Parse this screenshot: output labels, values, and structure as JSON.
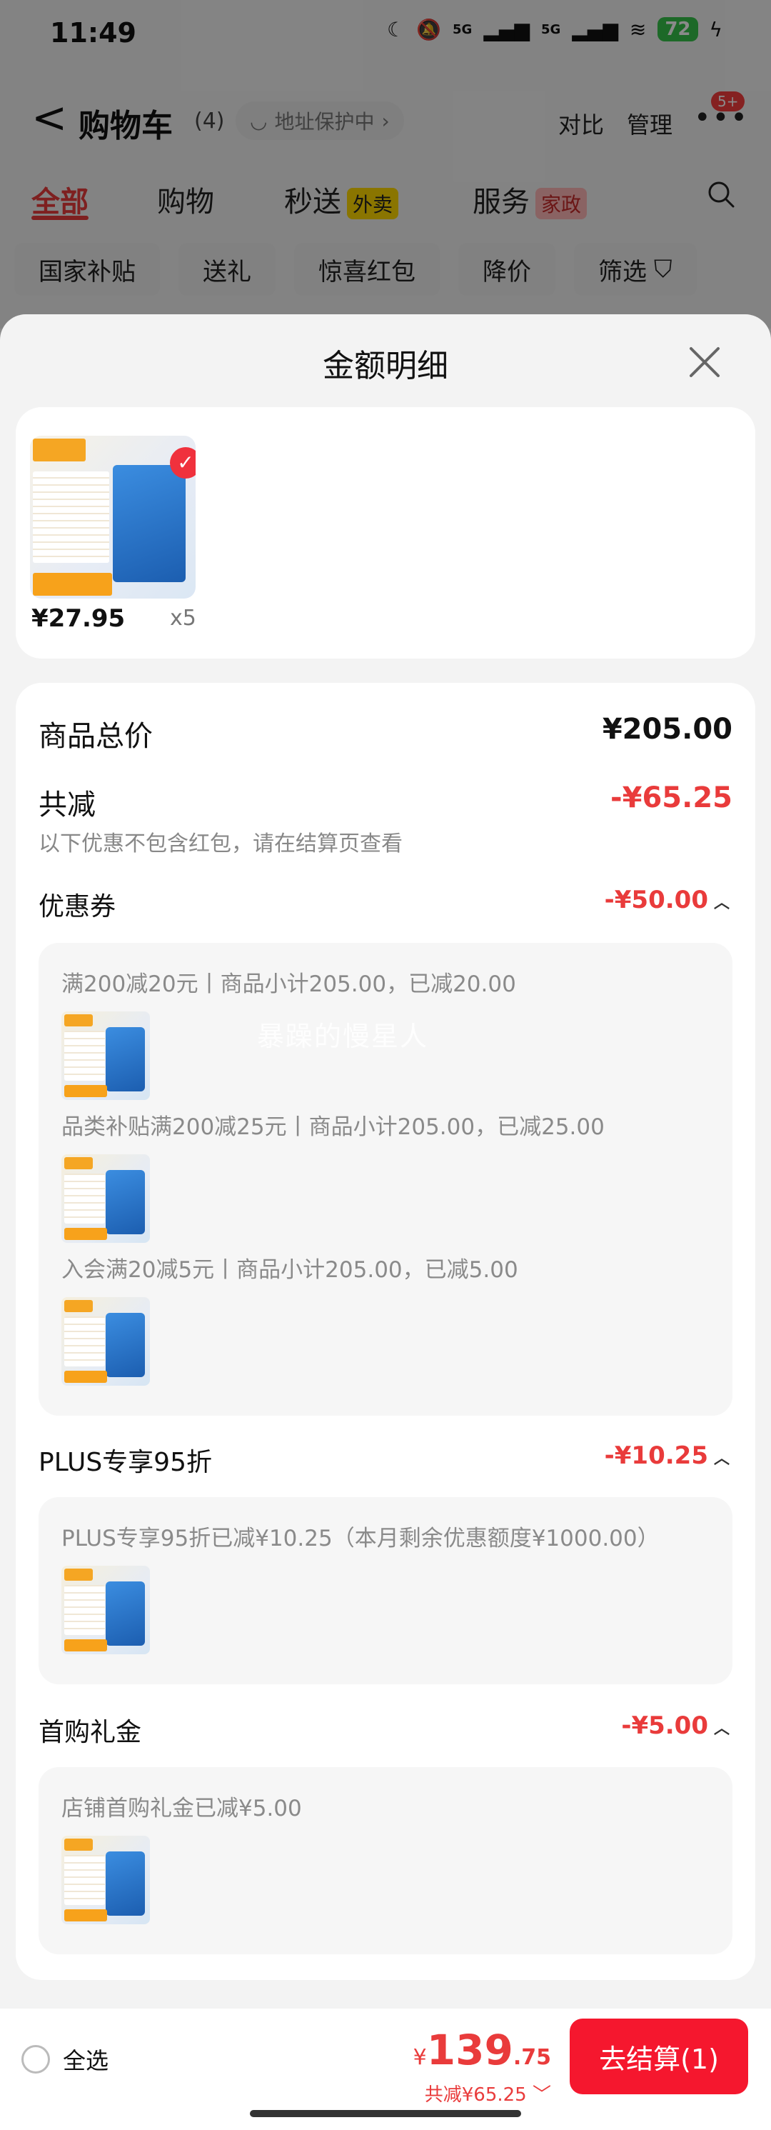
{
  "status_bar": {
    "time": "11:49",
    "signal1": "5G",
    "signal2": "5G",
    "battery": "72"
  },
  "nav": {
    "back_glyph": "<",
    "title": "购物车",
    "count": "(4)",
    "address_protect": "地址保护中",
    "compare": "对比",
    "manage": "管理",
    "more_badge": "5+"
  },
  "tabs": [
    {
      "label": "全部",
      "active": true
    },
    {
      "label": "购物"
    },
    {
      "label": "秒送",
      "tag": "外卖"
    },
    {
      "label": "服务",
      "tag": "家政"
    }
  ],
  "chips": [
    "国家补贴",
    "送礼",
    "惊喜红包",
    "降价",
    "筛选"
  ],
  "sheet": {
    "title": "金额明细",
    "product": {
      "price": "¥27.95",
      "qty": "x5"
    },
    "total_label": "商品总价",
    "total_value": "¥205.00",
    "reduce_label": "共减",
    "reduce_value": "-¥65.25",
    "reduce_note": "以下优惠不包含红包，请在结算页查看",
    "coupon": {
      "label": "优惠券",
      "value": "-¥50.00",
      "lines": [
        "满200减20元丨商品小计205.00，已减20.00",
        "品类补贴满200减25元丨商品小计205.00，已减25.00",
        "入会满20减5元丨商品小计205.00，已减5.00"
      ]
    },
    "watermark": "暴躁的慢星人",
    "plus": {
      "label": "PLUS专享95折",
      "value": "-¥10.25",
      "line": "PLUS专享95折已减¥10.25（本月剩余优惠额度¥1000.00）"
    },
    "gift": {
      "label": "首购礼金",
      "value": "-¥5.00",
      "line": "店铺首购礼金已减¥5.00"
    }
  },
  "bottom": {
    "select_all": "全选",
    "currency": "¥",
    "total_int": "139",
    "total_dec": ".75",
    "discount": "共减¥65.25",
    "checkout": "去结算(1)"
  },
  "colors": {
    "accent": "#e93b3b",
    "checkout_bg": "#f5172e",
    "battery": "#37c24b"
  }
}
